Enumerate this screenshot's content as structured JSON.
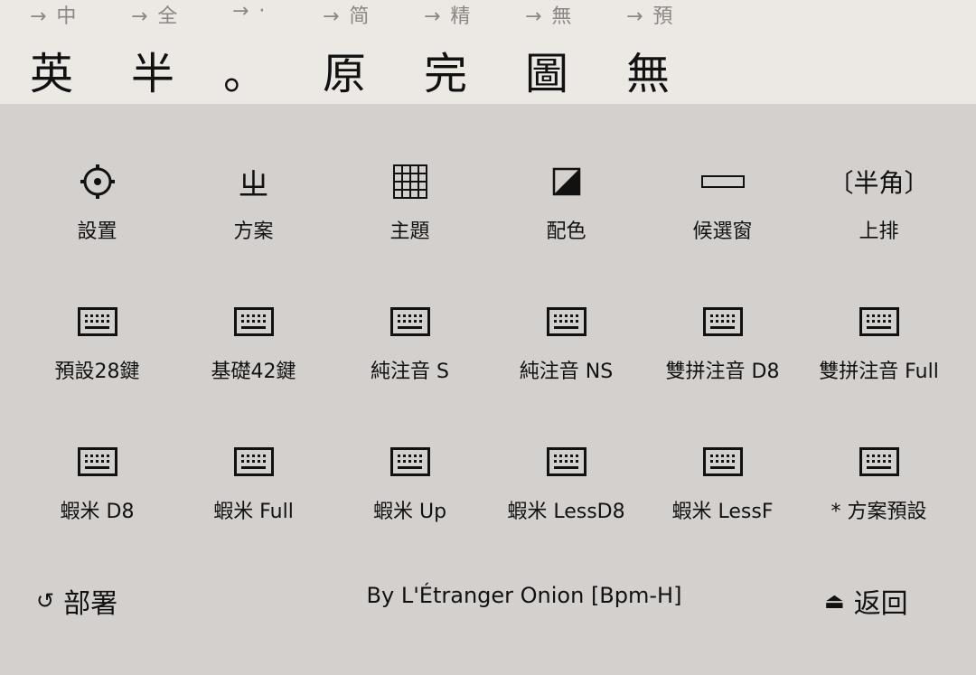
{
  "colors": {
    "top_bg": "#ece8e4",
    "body_bg": "#d4d0ce",
    "hint": "#8a8784",
    "text": "#111111"
  },
  "toggles": [
    {
      "hint": "→ 中",
      "state": "英"
    },
    {
      "hint": "→ 全",
      "state": "半"
    },
    {
      "hint": "→ ·",
      "state": "。"
    },
    {
      "hint": "→ 简",
      "state": "原"
    },
    {
      "hint": "→ 精",
      "state": "完"
    },
    {
      "hint": "→ 無",
      "state": "圖"
    },
    {
      "hint": "→ 預",
      "state": "無"
    }
  ],
  "menu": {
    "row1": [
      {
        "label": "設置",
        "icon": "gear-icon"
      },
      {
        "label": "方案",
        "icon": "zhuyin-zh-icon",
        "glyph": "ㄓ"
      },
      {
        "label": "主題",
        "icon": "grid-icon"
      },
      {
        "label": "配色",
        "icon": "half-filled-square-icon",
        "glyph": "◪"
      },
      {
        "label": "候選窗",
        "icon": "candidate-window-icon"
      },
      {
        "label": "上排",
        "icon": "half-width-icon",
        "glyph": "〔半角〕"
      }
    ],
    "row2": [
      {
        "label": "預設28鍵",
        "icon": "keyboard-icon"
      },
      {
        "label": "基礎42鍵",
        "icon": "keyboard-icon"
      },
      {
        "label": "純注音 S",
        "icon": "keyboard-icon"
      },
      {
        "label": "純注音 NS",
        "icon": "keyboard-icon"
      },
      {
        "label": "雙拼注音 D8",
        "icon": "keyboard-icon"
      },
      {
        "label": "雙拼注音 Full",
        "icon": "keyboard-icon"
      }
    ],
    "row3": [
      {
        "label": "蝦米 D8",
        "icon": "keyboard-icon"
      },
      {
        "label": "蝦米 Full",
        "icon": "keyboard-icon"
      },
      {
        "label": "蝦米 Up",
        "icon": "keyboard-icon"
      },
      {
        "label": "蝦米 LessD8",
        "icon": "keyboard-icon"
      },
      {
        "label": "蝦米 LessF",
        "icon": "keyboard-icon"
      },
      {
        "label": "* 方案預設",
        "icon": "keyboard-icon"
      }
    ]
  },
  "footer": {
    "deploy_icon": "↺",
    "deploy_label": "部署",
    "credit": "By L'Étranger Onion  [Bpm-H]",
    "back_icon": "⏏",
    "back_label": "返回"
  }
}
